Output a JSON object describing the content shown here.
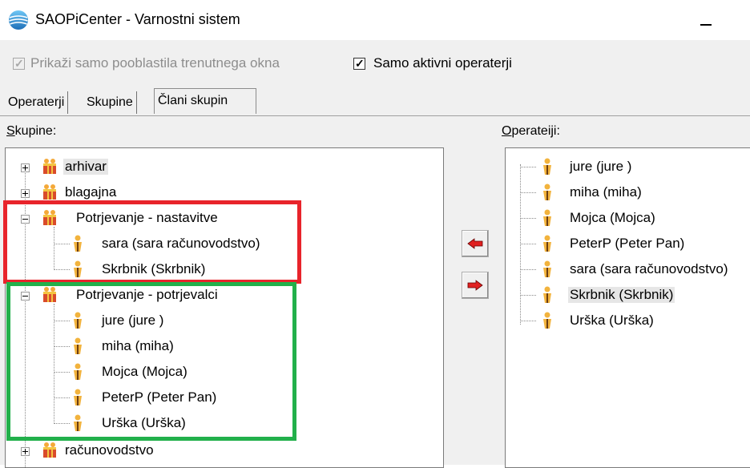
{
  "window": {
    "title": "SAOPiCenter - Varnostni sistem",
    "app_icon": "saop-globe-icon",
    "minimize_glyph": "minimize-icon"
  },
  "options": {
    "show_only_current_window": {
      "label": "Prikaži samo pooblastila trenutnega okna",
      "checked": true,
      "enabled": false
    },
    "only_active_operators": {
      "label": "Samo aktivni operaterji",
      "checked": true,
      "enabled": true
    }
  },
  "tabs": [
    {
      "label": "Operaterji",
      "active": false
    },
    {
      "label": "Skupine",
      "active": false
    },
    {
      "label": "Člani skupin",
      "active": true
    }
  ],
  "groups_panel": {
    "label_accel": "S",
    "label_rest": "kupine:",
    "nodes": [
      {
        "label": "arhivar",
        "type": "group",
        "expanded": false
      },
      {
        "label": "blagajna",
        "type": "group",
        "expanded": false
      },
      {
        "label": "Potrjevanje - nastavitve",
        "type": "group",
        "expanded": true,
        "children": [
          "sara (sara računovodstvo)",
          "Skrbnik (Skrbnik)"
        ]
      },
      {
        "label": "Potrjevanje - potrjevalci",
        "type": "group",
        "expanded": true,
        "children": [
          "jure (jure )",
          "miha (miha)",
          "Mojca (Mojca)",
          "PeterP (Peter Pan)",
          "Urška (Urška)"
        ]
      },
      {
        "label": "računovodstvo",
        "type": "group",
        "expanded": false
      }
    ]
  },
  "buttons": {
    "add": {
      "icon": "arrow-left-red-icon"
    },
    "remove": {
      "icon": "arrow-right-red-icon"
    }
  },
  "operators_panel": {
    "label_accel": "O",
    "label_rest": "perateiji:",
    "items": [
      "jure (jure )",
      "miha (miha)",
      "Mojca (Mojca)",
      "PeterP (Peter Pan)",
      "sara (sara računovodstvo)",
      "Skrbnik (Skrbnik)",
      "Urška (Urška)"
    ],
    "selected_index": 5
  },
  "annotations": {
    "red": "#e8242b",
    "green": "#22b04b"
  }
}
